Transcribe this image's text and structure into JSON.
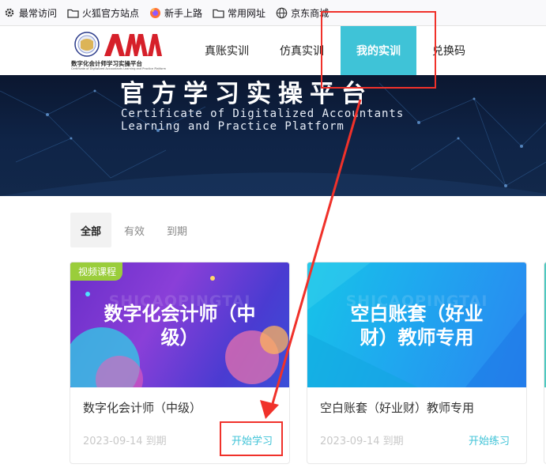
{
  "bookmarks": [
    {
      "label": "最常访问",
      "icon": "gear-icon"
    },
    {
      "label": "火狐官方站点",
      "icon": "folder-icon"
    },
    {
      "label": "新手上路",
      "icon": "firefox-icon"
    },
    {
      "label": "常用网址",
      "icon": "folder-icon"
    },
    {
      "label": "京东商城",
      "icon": "globe-icon"
    }
  ],
  "header": {
    "logo_text": "数字化会计师学习实操平台",
    "logo_subtext": "Certificate of Digitalized Accountants Learning and Practice Platform",
    "nav": [
      {
        "label": "真账实训"
      },
      {
        "label": "仿真实训"
      },
      {
        "label": "我的实训"
      },
      {
        "label": "兑换码"
      }
    ]
  },
  "banner": {
    "title": "官方学习实操平台",
    "subtitle_line1": "Certificate of Digitalized Accountants",
    "subtitle_line2": "Learning and Practice Platform"
  },
  "filters": [
    {
      "label": "全部"
    },
    {
      "label": "有效"
    },
    {
      "label": "到期"
    }
  ],
  "cards": [
    {
      "badge": "视频课程",
      "watermark": "SHICAOPINGTAI",
      "image_title_line1": "数字化会计师（中",
      "image_title_line2": "级）",
      "name": "数字化会计师（中级）",
      "date": "2023-09-14 到期",
      "action": "开始学习"
    },
    {
      "watermark": "SHICAOPINGTAI",
      "image_title_line1": "空白账套（好业",
      "image_title_line2": "财）教师专用",
      "name": "空白账套（好业财）教师专用",
      "date": "2023-09-14 到期",
      "action": "开始练习"
    }
  ],
  "colors": {
    "accent": "#3fc3d7",
    "annotation": "#f0312a",
    "badge": "#9acd3b"
  }
}
